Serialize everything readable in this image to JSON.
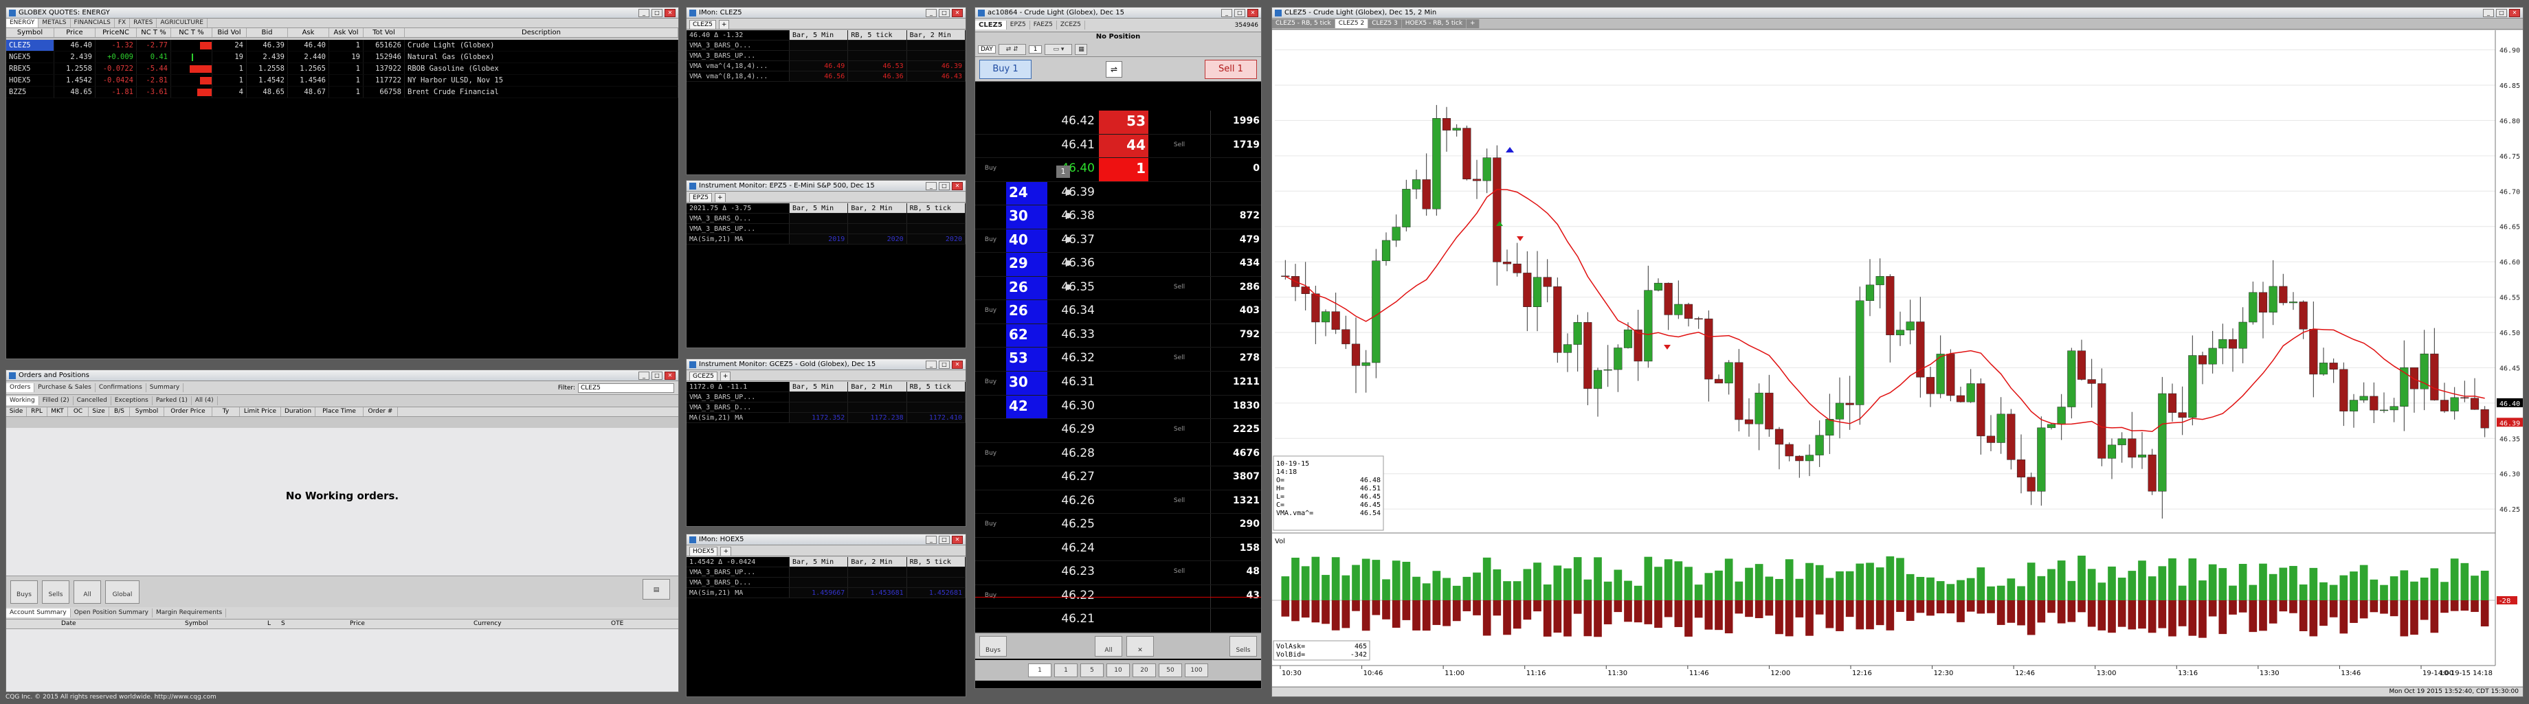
{
  "quotes": {
    "title": "GLOBEX QUOTES: ENERGY",
    "tabs": [
      "ENERGY",
      "METALS",
      "FINANCIALS",
      "FX",
      "RATES",
      "AGRICULTURE"
    ],
    "columns": [
      "Symbol",
      "Price",
      "PriceNC",
      "NC T %",
      "NC T %",
      "Bid Vol",
      "Bid",
      "Ask",
      "Ask Vol",
      "Tot Vol",
      "Description"
    ],
    "rows": [
      {
        "sym": "CLEZ5",
        "price": "46.40",
        "pnc": "-1.32",
        "nct": "-2.77",
        "bidvol": "24",
        "bid": "46.39",
        "ask": "46.40",
        "askvol": "1",
        "tot": "651626",
        "desc": "Crude Light (Globex)",
        "bar": 0.28,
        "pos": false
      },
      {
        "sym": "NGEX5",
        "price": "2.439",
        "pnc": "+0.009",
        "nct": "0.41",
        "bidvol": "19",
        "bid": "2.439",
        "ask": "2.440",
        "askvol": "19",
        "tot": "152946",
        "desc": "Natural Gas (Globex)",
        "bar": 0.05,
        "pos": true
      },
      {
        "sym": "RBEX5",
        "price": "1.2558",
        "pnc": "-0.0722",
        "nct": "-5.44",
        "bidvol": "1",
        "bid": "1.2558",
        "ask": "1.2565",
        "askvol": "1",
        "tot": "137922",
        "desc": "RBOB Gasoline (Globex",
        "bar": 0.55,
        "pos": false
      },
      {
        "sym": "HOEX5",
        "price": "1.4542",
        "pnc": "-0.0424",
        "nct": "-2.81",
        "bidvol": "1",
        "bid": "1.4542",
        "ask": "1.4546",
        "askvol": "1",
        "tot": "117722",
        "desc": "NY Harbor ULSD, Nov 15",
        "bar": 0.29,
        "pos": false
      },
      {
        "sym": "BZZ5",
        "price": "48.65",
        "pnc": "-1.81",
        "nct": "-3.61",
        "bidvol": "4",
        "bid": "48.65",
        "ask": "48.67",
        "askvol": "1",
        "tot": "66758",
        "desc": "Brent Crude Financial",
        "bar": 0.36,
        "pos": false
      }
    ]
  },
  "orders": {
    "title": "Orders and Positions",
    "tabs": [
      "Orders",
      "Purchase & Sales",
      "Confirmations",
      "Summary"
    ],
    "filter_label": "Filter:",
    "filter_value": "CLEZ5",
    "subtabs": [
      "Working",
      "Filled (2)",
      "Cancelled",
      "Exceptions",
      "Parked (1)",
      "All (4)"
    ],
    "columns": [
      "Side",
      "RPL",
      "MKT",
      "OC",
      "Size",
      "B/S",
      "Symbol",
      "Order Price",
      "Ty",
      "Limit Price",
      "Duration",
      "Place Time",
      "Order #"
    ],
    "empty": "No Working orders.",
    "buttons": [
      "Buys",
      "Sells",
      "All",
      "Global"
    ],
    "bottom_tabs": [
      "Account Summary",
      "Open Position Summary",
      "Margin Requirements"
    ],
    "bottom_cols": [
      "Date",
      "Symbol",
      "L",
      "S",
      "Price",
      "Currency",
      "OTE"
    ]
  },
  "imon": [
    {
      "title": "IMon: CLEZ5",
      "sym": "CLEZ5",
      "price": "46.40 Δ -1.32",
      "cols": [
        "Bar, 5 Min",
        "RB, 5 tick",
        "Bar, 2 Min"
      ],
      "rows": [
        [
          "VMA_3_BARS_O...",
          "",
          "",
          ""
        ],
        [
          "VMA_3_BARS_UP...",
          "",
          "",
          ""
        ],
        [
          "VMA vma^(4,18,4)...",
          "46.49",
          "46.53",
          "46.39"
        ],
        [
          "VMA vma^(8,18,4)...",
          "46.56",
          "46.36",
          "46.43"
        ]
      ],
      "vcolor": "#d22"
    },
    {
      "title": "Instrument Monitor: EPZ5 - E-Mini S&P 500, Dec 15",
      "sym": "EPZ5",
      "price": "2021.75 Δ -3.75",
      "cols": [
        "Bar, 5 Min",
        "Bar, 2 Min",
        "RB, 5 tick"
      ],
      "rows": [
        [
          "VMA_3_BARS_O...",
          "",
          "",
          ""
        ],
        [
          "VMA_3_BARS_UP...",
          "",
          "",
          ""
        ],
        [
          "MA(Sim,21) MA",
          "2019",
          "2020",
          "2020"
        ]
      ],
      "vcolor": "#33c"
    },
    {
      "title": "Instrument Monitor: GCEZ5 - Gold (Globex), Dec 15",
      "sym": "GCEZ5",
      "price": "1172.0 Δ -11.1",
      "cols": [
        "Bar, 5 Min",
        "Bar, 2 Min",
        "RB, 5 tick"
      ],
      "rows": [
        [
          "VMA_3_BARS_UP...",
          "",
          "",
          ""
        ],
        [
          "VMA_3_BARS_D...",
          "",
          "",
          ""
        ],
        [
          "MA(Sim,21) MA",
          "1172.352",
          "1172.238",
          "1172.410"
        ]
      ],
      "vcolor": "#33c"
    },
    {
      "title": "IMon: HOEX5",
      "sym": "HOEX5",
      "price": "1.4542 Δ -0.0424",
      "cols": [
        "Bar, 5 Min",
        "Bar, 2 Min",
        "RB, 5 tick"
      ],
      "rows": [
        [
          "VMA_3_BARS_UP...",
          "",
          "",
          ""
        ],
        [
          "VMA_3_BARS_D...",
          "",
          "",
          ""
        ],
        [
          "MA(Sim,21) MA",
          "1.459667",
          "1.453681",
          "1.452681"
        ]
      ],
      "vcolor": "#33c"
    }
  ],
  "dom": {
    "title": "ac10864 - Crude Light (Globex), Dec 15",
    "tabs": [
      "CLEZ5",
      "EPZ5",
      "FAEZ5",
      "ZCEZ5"
    ],
    "status": "No Position",
    "day": "DAY",
    "qty": "1",
    "buy_btn": "Buy 1",
    "sell_btn": "Sell 1",
    "vol_top": "354946",
    "prices": [
      "46.42",
      "46.41",
      "46.40",
      "46.39",
      "46.38",
      "46.37",
      "46.36",
      "46.35",
      "46.34",
      "46.33",
      "46.32",
      "46.31",
      "46.30",
      "46.29",
      "46.28",
      "46.27",
      "46.26",
      "46.25",
      "46.24",
      "46.23",
      "46.22",
      "46.21"
    ],
    "bids": [
      "",
      "",
      "",
      "24",
      "30",
      "40",
      "29",
      "26",
      "26",
      "62",
      "53",
      "30",
      "42",
      "",
      "",
      "",
      "",
      "",
      "",
      "",
      "",
      ""
    ],
    "asks": [
      "53",
      "44",
      "1",
      "",
      "",
      "",
      "",
      "",
      "",
      "",
      "",
      "",
      "",
      "",
      "",
      "",
      "",
      "",
      "",
      "",
      "",
      ""
    ],
    "vols": [
      "1996",
      "1719",
      "0",
      "",
      "872",
      "479",
      "434",
      "286",
      "403",
      "792",
      "278",
      "1211",
      "1830",
      "2225",
      "4676",
      "3807",
      "1321",
      "290",
      "158",
      "48",
      "43",
      ""
    ],
    "buy": "Buy",
    "sell": "Sell",
    "qty_buttons": [
      "1",
      "1",
      "5",
      "10",
      "20",
      "50",
      "100"
    ],
    "bottom_btns": [
      "Buys",
      "All",
      "Sells"
    ]
  },
  "chart": {
    "title": "CLEZ5 - Crude Light (Globex), Dec 15, 2 Min",
    "tabs": [
      "CLEZ5 - RB, 5 tick",
      "CLEZ5 2",
      "CLEZ5 3",
      "HOEX5 - RB, 5 tick"
    ],
    "y_labels": [
      "46.90",
      "46.85",
      "46.80",
      "46.75",
      "46.70",
      "46.65",
      "46.60",
      "46.55",
      "46.50",
      "46.45",
      "46.40",
      "46.35",
      "46.30",
      "46.25"
    ],
    "x_labels": [
      "10:30",
      "10:46",
      "11:00",
      "11:16",
      "11:30",
      "11:46",
      "12:00",
      "12:16",
      "12:30",
      "12:46",
      "13:00",
      "13:16",
      "13:30",
      "13:46",
      "19-14:00"
    ],
    "x_right": "10-19-15 14:18",
    "info": [
      "10-19-15",
      "14:18",
      "O=",
      "H=",
      "L=",
      "C=",
      "VMA.vma^="
    ],
    "info_vals": [
      "",
      "",
      "46.48",
      "46.51",
      "46.45",
      "46.45",
      "46.54"
    ],
    "price_tag": "46.40",
    "price_tag2": "46.39",
    "vol_label": "Vol",
    "vol_info": [
      "VolAsk=",
      "VolBid="
    ],
    "vol_vals": [
      "465",
      "-342"
    ],
    "vol_tag": "-28",
    "status_time": "Mon Oct 19 2015 13:52:40, CDT 15:30:00"
  },
  "footer": "CQG Inc. © 2015 All rights reserved worldwide. http://www.cqg.com"
}
